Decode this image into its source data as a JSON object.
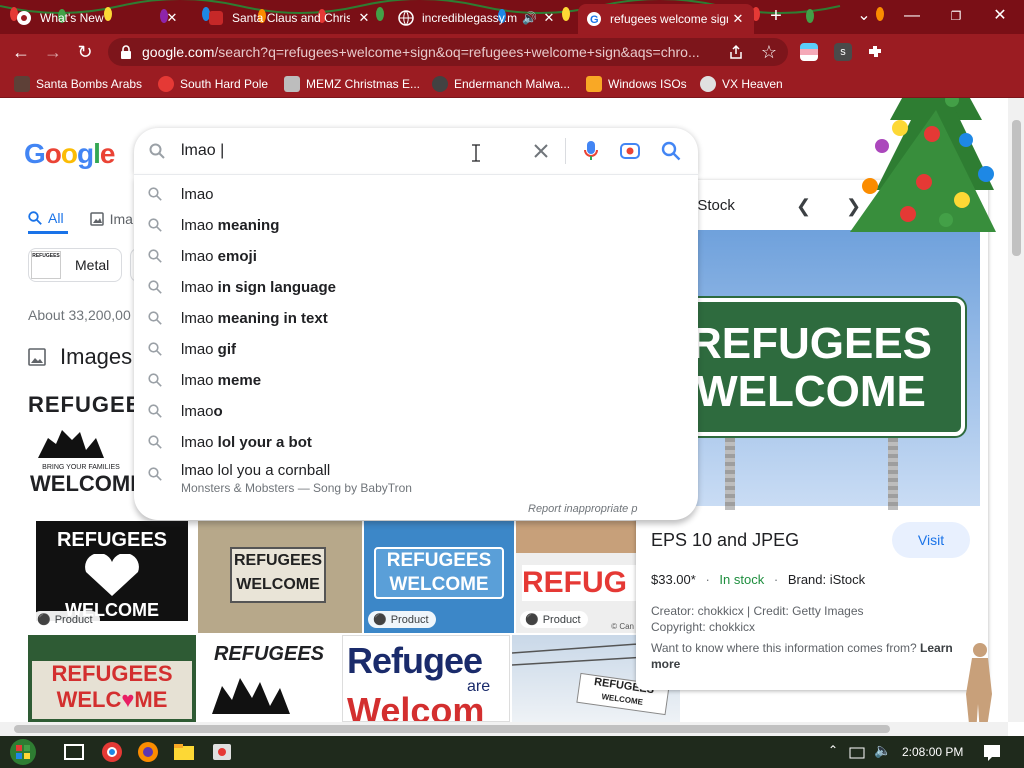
{
  "browser": {
    "tabs": [
      {
        "title": "What's New",
        "close": "✕"
      },
      {
        "title": "Santa Claus and Christ",
        "close": "✕"
      },
      {
        "title": "incrediblegassy.m",
        "close": "✕"
      },
      {
        "title": "refugees welcome sign",
        "close": "✕"
      }
    ],
    "new_tab": "+",
    "url_host": "google.com",
    "url_path": "/search?q=refugees+welcome+sign&oq=refugees+welcome+sign&aqs=chro...",
    "bookmarks": [
      "Santa Bombs Arabs",
      "South Hard Pole",
      "MEMZ Christmas E...",
      "Endermanch Malwa...",
      "Windows ISOs",
      "VX Heaven"
    ]
  },
  "search": {
    "logo": "Google",
    "query": "lmao |",
    "suggestions": [
      {
        "prefix": "lmao",
        "bold": ""
      },
      {
        "prefix": "lmao",
        "bold": " meaning"
      },
      {
        "prefix": "lmao",
        "bold": " emoji"
      },
      {
        "prefix": "lmao",
        "bold": " in sign language"
      },
      {
        "prefix": "lmao",
        "bold": " meaning in text"
      },
      {
        "prefix": "lmao",
        "bold": " gif"
      },
      {
        "prefix": "lmao",
        "bold": " meme"
      },
      {
        "prefix": "lmao",
        "bold": "o"
      },
      {
        "prefix": "lmao",
        "bold": " lol your a bot"
      }
    ],
    "last_suggestion": {
      "text": "lmao lol you a cornball",
      "sub": "Monsters & Mobsters — Song by BabyTron"
    },
    "report": "Report inappropriate p"
  },
  "results": {
    "tab_all": "All",
    "tab_images": "Ima",
    "chip": "Metal",
    "count": "About 33,200,00",
    "images_header": "Images",
    "thumb_texts": {
      "t1": "REFUGEES",
      "t1b": "WELCOME",
      "t1c": "BRING YOUR FAMILIES",
      "t2": "REFUGEES",
      "t2b": "WELCOME",
      "t3": "REFUGEES",
      "t3b": "WELCOME",
      "t4": "REFUGEES",
      "t4b": "WELCOME",
      "t5": "REFUG",
      "t6": "REFUGEES",
      "t6b": "WELC",
      "t6c": "ME",
      "t7": "REFUGEES",
      "t8": "Refugee",
      "t8b": "are",
      "t8c": "Welcom",
      "t9": "REFUGEES",
      "t9b": "WELCOME"
    },
    "product_label": "Product",
    "credit_snip": "© Can"
  },
  "panel": {
    "brand": "iStock",
    "image_line1": "REFUGEES",
    "image_line2": "WELCOME",
    "title": "EPS 10 and JPEG",
    "visit": "Visit",
    "price": "$33.00*",
    "stock": "In stock",
    "brand_line": "Brand: iStock",
    "creator": "Creator: chokkicx | Credit: Getty Images",
    "copyright": "Copyright: chokkicx",
    "question": "Want to know where this information comes from?",
    "learn_more": "Learn more"
  },
  "taskbar": {
    "clock": "2:08:00 PM"
  },
  "colors": {
    "chrome_frame": "#9b1c22",
    "tab_strip": "#7a0f16",
    "google_blue": "#1a73e8",
    "stock_green": "#1e8e3e",
    "sign_green": "#2e6b3e"
  }
}
